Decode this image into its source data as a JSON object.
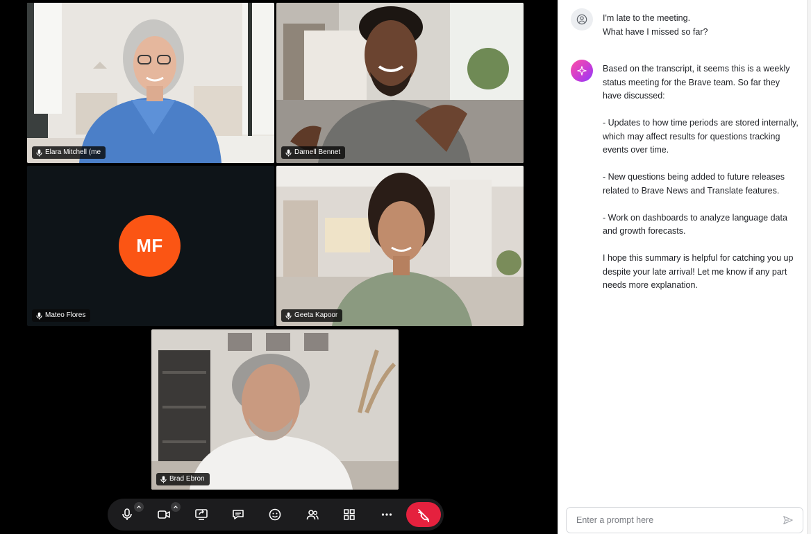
{
  "participants": [
    {
      "name": "Elara Mitchell (me",
      "icon": "microphone-icon"
    },
    {
      "name": "Darnell Bennet",
      "icon": "microphone-icon"
    },
    {
      "name": "Mateo Flores",
      "icon": "microphone-icon",
      "initials": "MF",
      "avatar_color": "#fb5514"
    },
    {
      "name": "Geeta Kapoor",
      "icon": "microphone-icon"
    },
    {
      "name": "Brad Ebron",
      "icon": "microphone-icon"
    }
  ],
  "controls": {
    "items": [
      "microphone-icon",
      "camera-icon",
      "screen-share-icon",
      "chat-icon",
      "emoji-icon",
      "participants-icon",
      "grid-layout-icon",
      "more-icon"
    ],
    "end_call": {
      "icon": "end-call-icon",
      "color": "#e5213e"
    }
  },
  "chat": {
    "user_message": "I'm late to the meeting.\nWhat have I missed so far?",
    "assistant_message": "Based on the transcript, it seems this is a weekly status meeting for the Brave team. So far they have discussed:\n\n- Updates to how time periods are stored internally, which may affect results for questions tracking events over time.\n\n- New questions being added to future releases related to Brave News and Translate features.\n\n- Work on dashboards to analyze language data and growth forecasts.\n\nI hope this summary is helpful for catching you up despite your late arrival! Let me know if any part needs more explanation.",
    "prompt_placeholder": "Enter a prompt here",
    "accent_gradient": [
      "#ff4fa3",
      "#8a3ffc"
    ]
  }
}
